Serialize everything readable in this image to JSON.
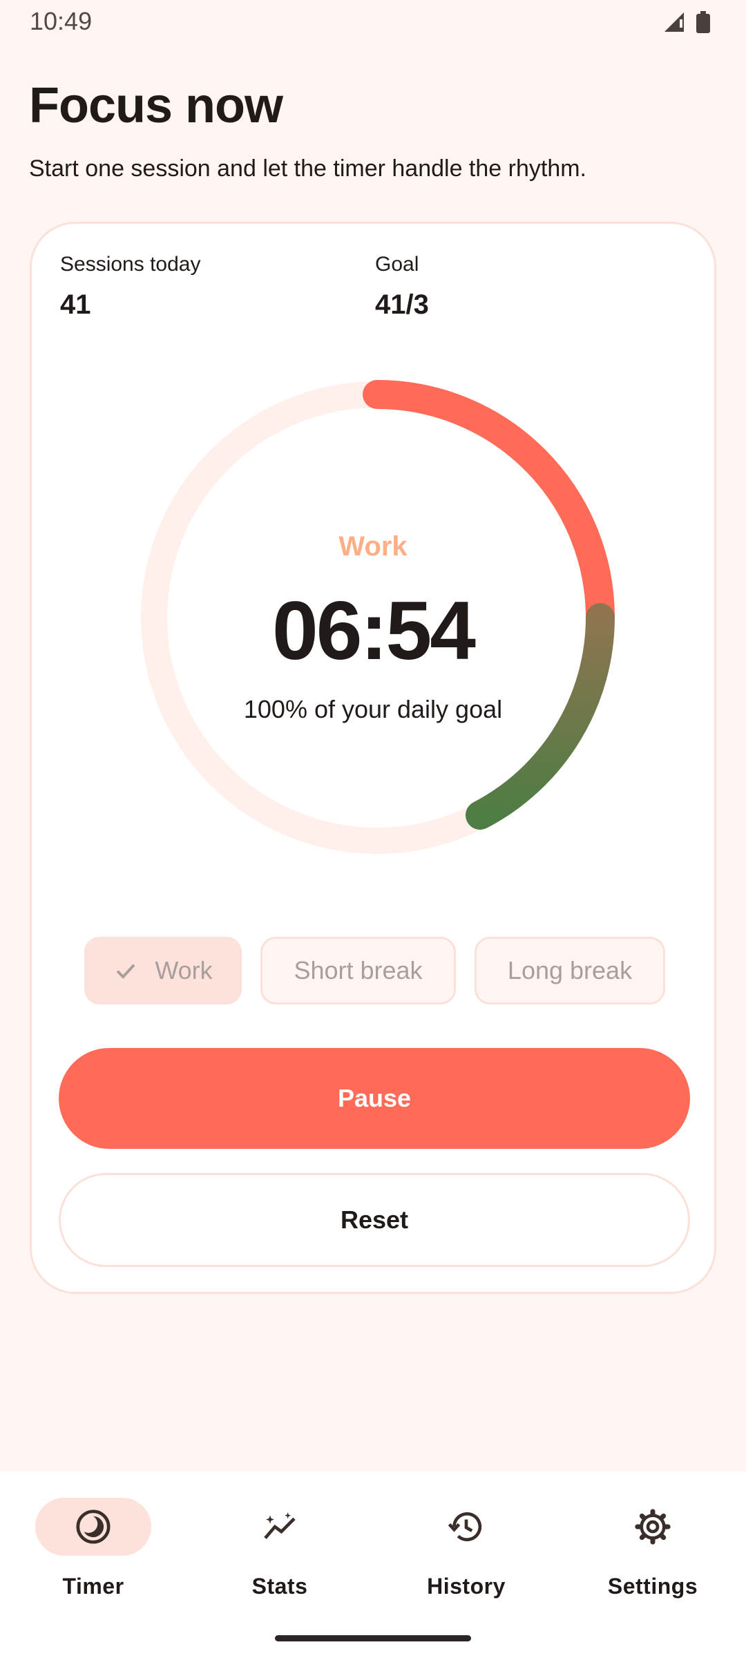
{
  "status_bar": {
    "time": "10:49"
  },
  "header": {
    "title": "Focus now",
    "subtitle": "Start one session and let the timer handle the rhythm."
  },
  "stats": {
    "sessions_label": "Sessions today",
    "sessions_value": "41",
    "goal_label": "Goal",
    "goal_value": "41/3"
  },
  "timer": {
    "mode": "Work",
    "time": "06:54",
    "goal_text": "100% of your daily goal",
    "progress_fraction": 0.38
  },
  "modes": [
    {
      "label": "Work",
      "selected": true
    },
    {
      "label": "Short break",
      "selected": false
    },
    {
      "label": "Long break",
      "selected": false
    }
  ],
  "actions": {
    "pause_label": "Pause",
    "reset_label": "Reset"
  },
  "nav": [
    {
      "label": "Timer",
      "icon": "timer-icon",
      "active": true
    },
    {
      "label": "Stats",
      "icon": "stats-icon",
      "active": false
    },
    {
      "label": "History",
      "icon": "history-icon",
      "active": false
    },
    {
      "label": "Settings",
      "icon": "settings-icon",
      "active": false
    }
  ],
  "colors": {
    "accent": "#FF6B57",
    "ring_track": "#FFF0EC",
    "ring_end": "#4E7C45",
    "mode_label": "#FFAE85",
    "chip_selected": "#FDE2DB",
    "background": "#FFF5F2"
  }
}
